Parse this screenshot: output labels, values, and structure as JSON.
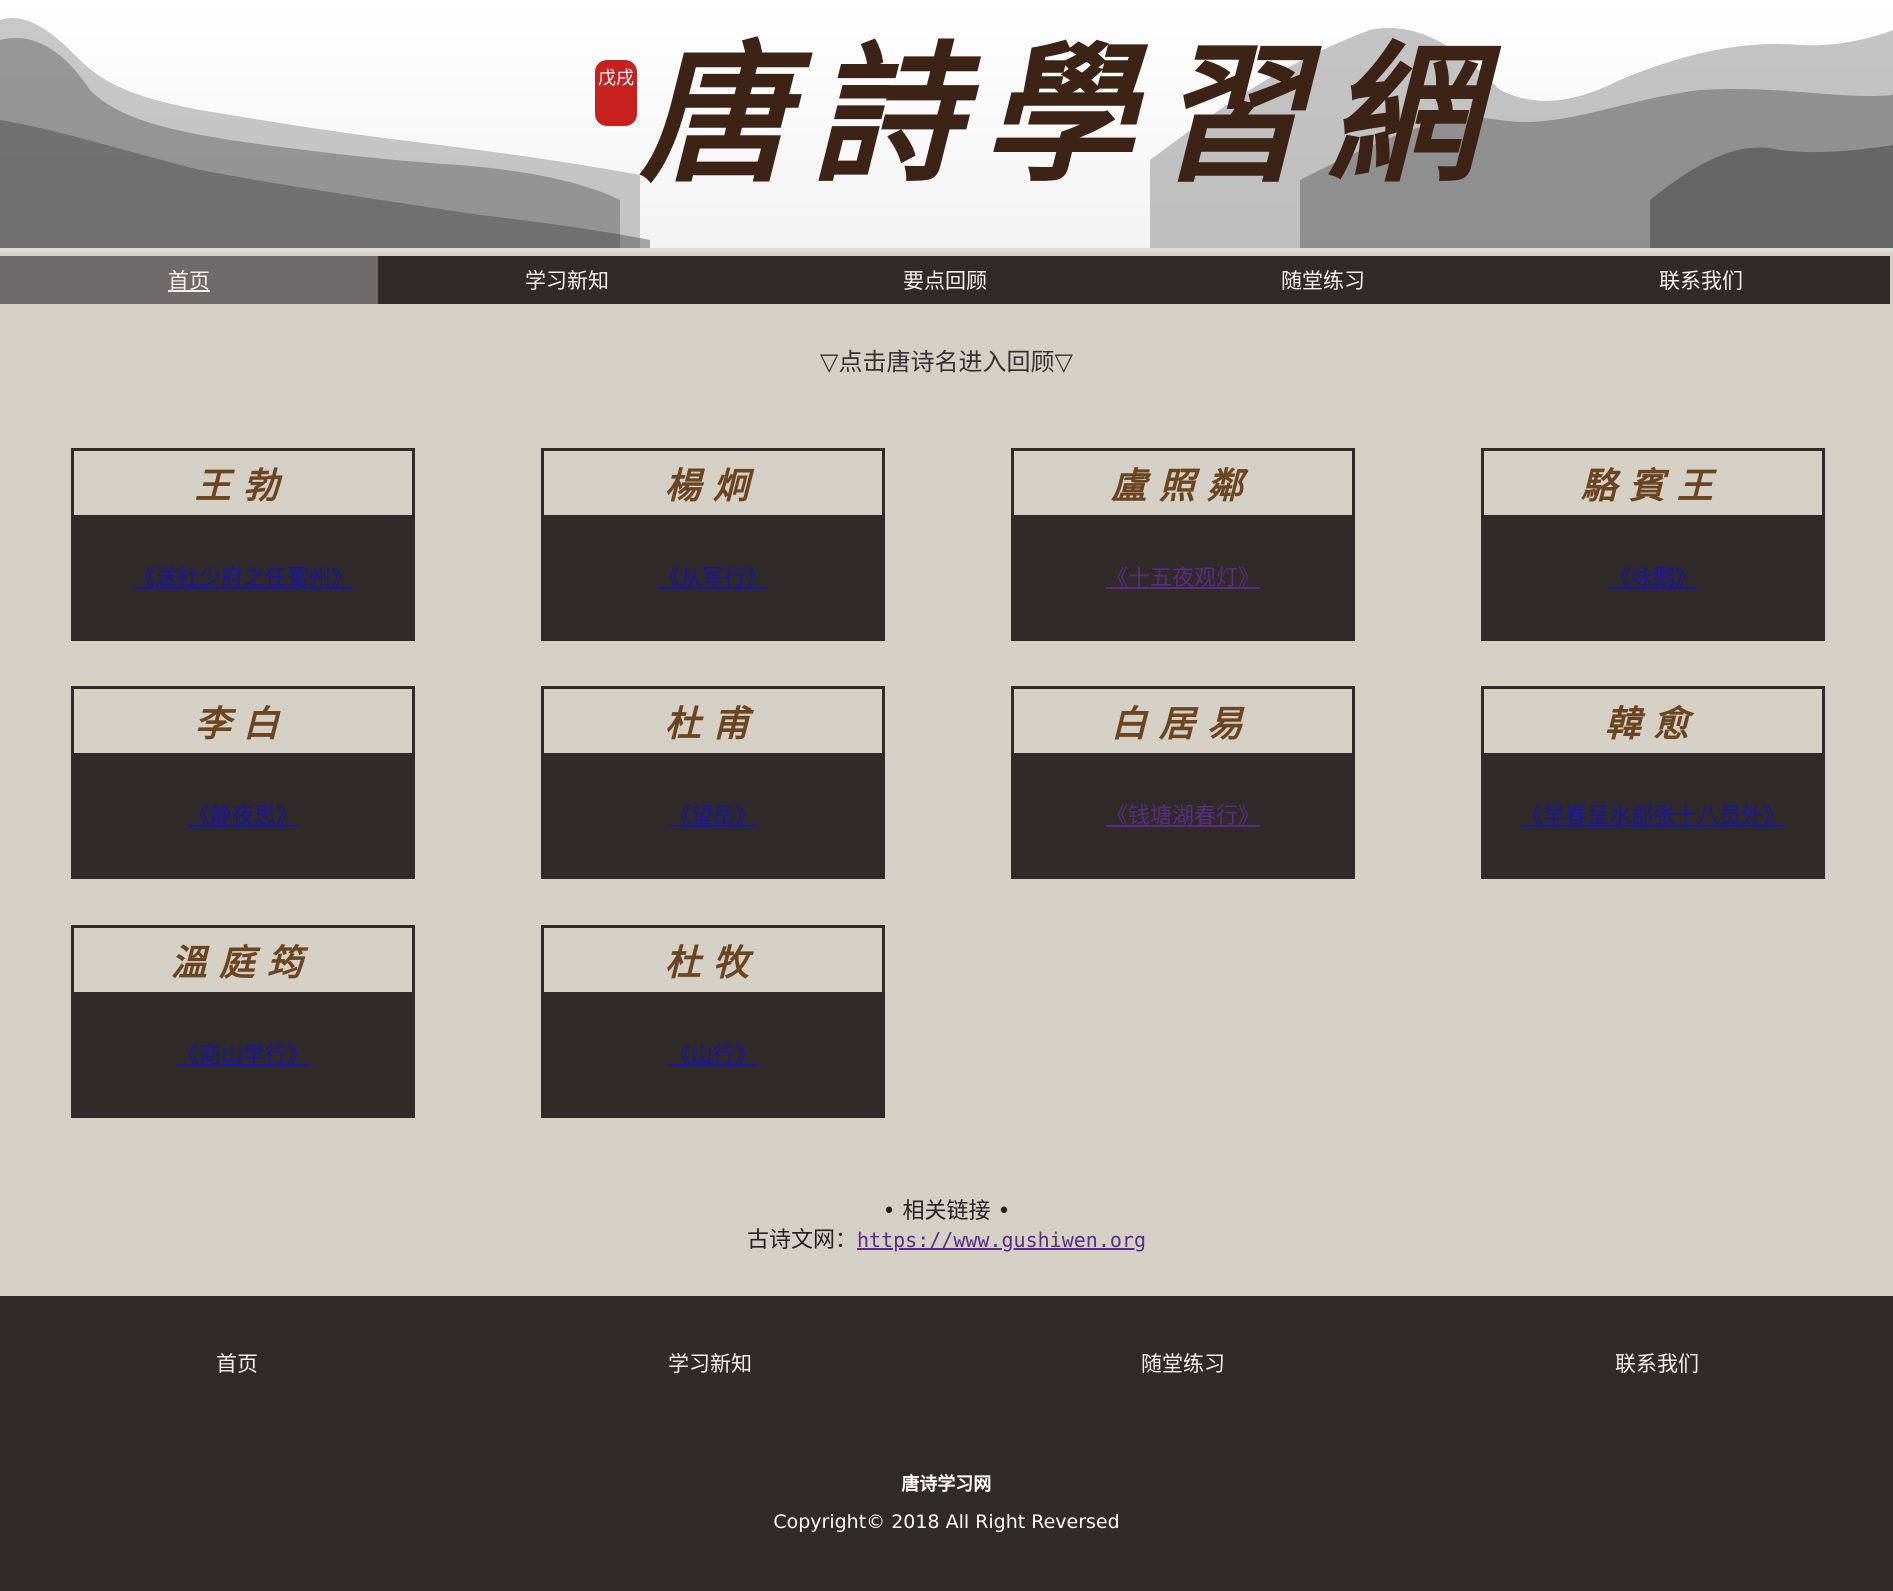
{
  "banner": {
    "title": "唐詩學習網",
    "seal": "戊戌"
  },
  "nav": {
    "items": [
      "首页",
      "学习新知",
      "要点回顾",
      "随堂练习",
      "联系我们"
    ],
    "active": "首页"
  },
  "hint": "▽点击唐诗名进入回顾▽",
  "poets": [
    {
      "name": "王勃",
      "poem": "《送杜少府之任蜀州》"
    },
    {
      "name": "楊炯",
      "poem": "《从军行》"
    },
    {
      "name": "盧照鄰",
      "poem": "《十五夜观灯》"
    },
    {
      "name": "駱賓王",
      "poem": "《咏鹅》"
    },
    {
      "name": "李白",
      "poem": "《静夜思》"
    },
    {
      "name": "杜甫",
      "poem": "《望岳》"
    },
    {
      "name": "白居易",
      "poem": "《钱塘湖春行》"
    },
    {
      "name": "韓愈",
      "poem": "《早春呈水部张十八员外》"
    },
    {
      "name": "溫庭筠",
      "poem": "《商山早行》"
    },
    {
      "name": "杜牧",
      "poem": "《山行》"
    }
  ],
  "related": {
    "title": "• 相关链接 •",
    "label": "古诗文网：",
    "url": "https://www.gushiwen.org"
  },
  "footer": {
    "items": [
      "首页",
      "学习新知",
      "随堂练习",
      "联系我们"
    ],
    "site_name": "唐诗学习网",
    "copyright": "Copyright© 2018 All Right Reversed"
  },
  "colors": {
    "background": "#d5d0c5",
    "dark": "#302a28",
    "nav_active": "#6c6a6a",
    "link": "#1a16a8",
    "link_visited": "#5a2d82",
    "poet_name": "#6b4520"
  }
}
